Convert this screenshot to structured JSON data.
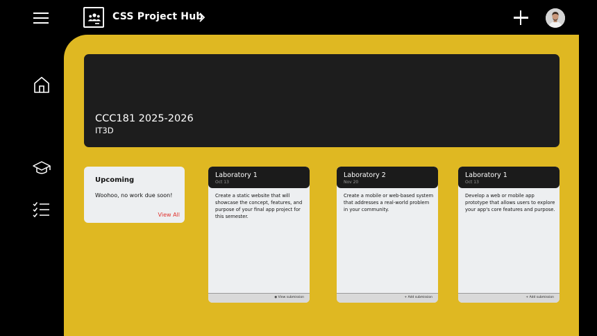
{
  "header": {
    "app_title": "CSS Project Hub"
  },
  "course": {
    "name": "CCC181 2025-2026",
    "section": "IT3D"
  },
  "upcoming": {
    "title": "Upcoming",
    "message": "Woohoo, no work due soon!",
    "view_all_label": "View All"
  },
  "assignments": [
    {
      "title": "Laboratory 1",
      "date": "Oct 13",
      "description": "Create a static website that will showcase the concept, features, and purpose of your final app project for this semester.",
      "action_label": "View submission",
      "action_icon": "eye-icon"
    },
    {
      "title": "Laboratory 2",
      "date": "Nov 20",
      "description": "Create a mobile or web-based system that addresses a real-world problem in your community.",
      "action_label": "Add submission",
      "action_icon": "plus-icon"
    },
    {
      "title": "Laboratory 1",
      "date": "Oct 13",
      "description": "Develop a web or mobile app prototype that allows users to explore your app's core features and purpose.",
      "action_label": "Add submission",
      "action_icon": "plus-icon"
    }
  ],
  "colors": {
    "background": "#000000",
    "panel": "#dfb822",
    "banner": "#1d1d1d",
    "card": "#edeff1",
    "link": "#e0322e"
  }
}
